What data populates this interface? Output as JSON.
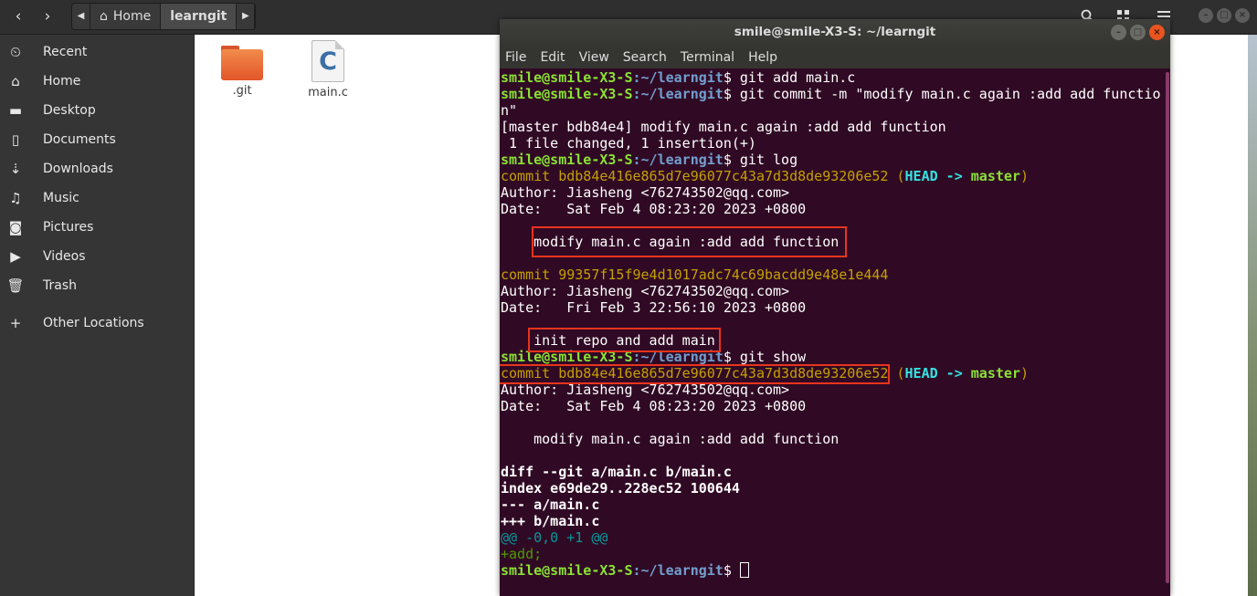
{
  "file_manager": {
    "nav": {
      "back_icon": "‹",
      "forward_icon": "›"
    },
    "pathbar": {
      "left_arrow": "◀",
      "home_label": "Home",
      "current_label": "learngit",
      "right_arrow": "▶"
    },
    "sidebar": {
      "items": [
        {
          "label": "Recent",
          "icon": "⏲"
        },
        {
          "label": "Home",
          "icon": "⌂"
        },
        {
          "label": "Desktop",
          "icon": "▬"
        },
        {
          "label": "Documents",
          "icon": "▯"
        },
        {
          "label": "Downloads",
          "icon": "⇣"
        },
        {
          "label": "Music",
          "icon": "♫"
        },
        {
          "label": "Pictures",
          "icon": "◙"
        },
        {
          "label": "Videos",
          "icon": "▶"
        },
        {
          "label": "Trash",
          "icon": "🗑"
        },
        {
          "label": "Other Locations",
          "icon": "+"
        }
      ]
    },
    "files": [
      {
        "name": ".git",
        "type": "folder"
      },
      {
        "name": "main.c",
        "type": "c-source",
        "icon_letter": "C"
      }
    ]
  },
  "terminal": {
    "title": "smile@smile-X3-S: ~/learngit",
    "menu": [
      "File",
      "Edit",
      "View",
      "Search",
      "Terminal",
      "Help"
    ],
    "prompt_user": "smile@smile-X3-S",
    "prompt_path": ":~/learngit",
    "prompt_dollar": "$ ",
    "lines": {
      "cmd_add": "git add main.c",
      "cmd_commit": "git commit -m \"modify main.c again :add add functio",
      "cmd_commit_wrap": "n\"",
      "commit_result": "[master bdb84e4] modify main.c again :add add function",
      "commit_stats": " 1 file changed, 1 insertion(+)",
      "cmd_log": "git log",
      "log1_commit": "commit bdb84e416e865d7e96077c43a7d3d8de93206e52",
      "log1_ref_open": " (",
      "log1_head": "HEAD -> ",
      "log1_master": "master",
      "log1_ref_close": ")",
      "log1_author": "Author: Jiasheng <762743502@qq.com>",
      "log1_date": "Date:   Sat Feb 4 08:23:20 2023 +0800",
      "log1_msg": "    modify main.c again :add add function",
      "log2_commit": "commit 99357f15f9e4d1017adc74c69bacdd9e48e1e444",
      "log2_author": "Author: Jiasheng <762743502@qq.com>",
      "log2_date": "Date:   Fri Feb 3 22:56:10 2023 +0800",
      "log2_msg": "    init repo and add main",
      "cmd_show": "git show",
      "show_commit": "commit bdb84e416e865d7e96077c43a7d3d8de93206e52",
      "show_author": "Author: Jiasheng <762743502@qq.com>",
      "show_date": "Date:   Sat Feb 4 08:23:20 2023 +0800",
      "show_msg": "    modify main.c again :add add function",
      "diff_git": "diff --git a/main.c b/main.c",
      "diff_index": "index e69de29..228ec52 100644",
      "diff_minus": "--- a/main.c",
      "diff_plus": "+++ b/main.c",
      "diff_hunk": "@@ -0,0 +1 @@",
      "diff_add": "+add;"
    }
  },
  "colors": {
    "terminal_bg": "#300a24",
    "prompt_green": "#8ae234",
    "prompt_blue": "#729fcf",
    "commit_yellow": "#c4a000",
    "head_cyan": "#34e2e2",
    "highlight_red": "#e8341c"
  }
}
